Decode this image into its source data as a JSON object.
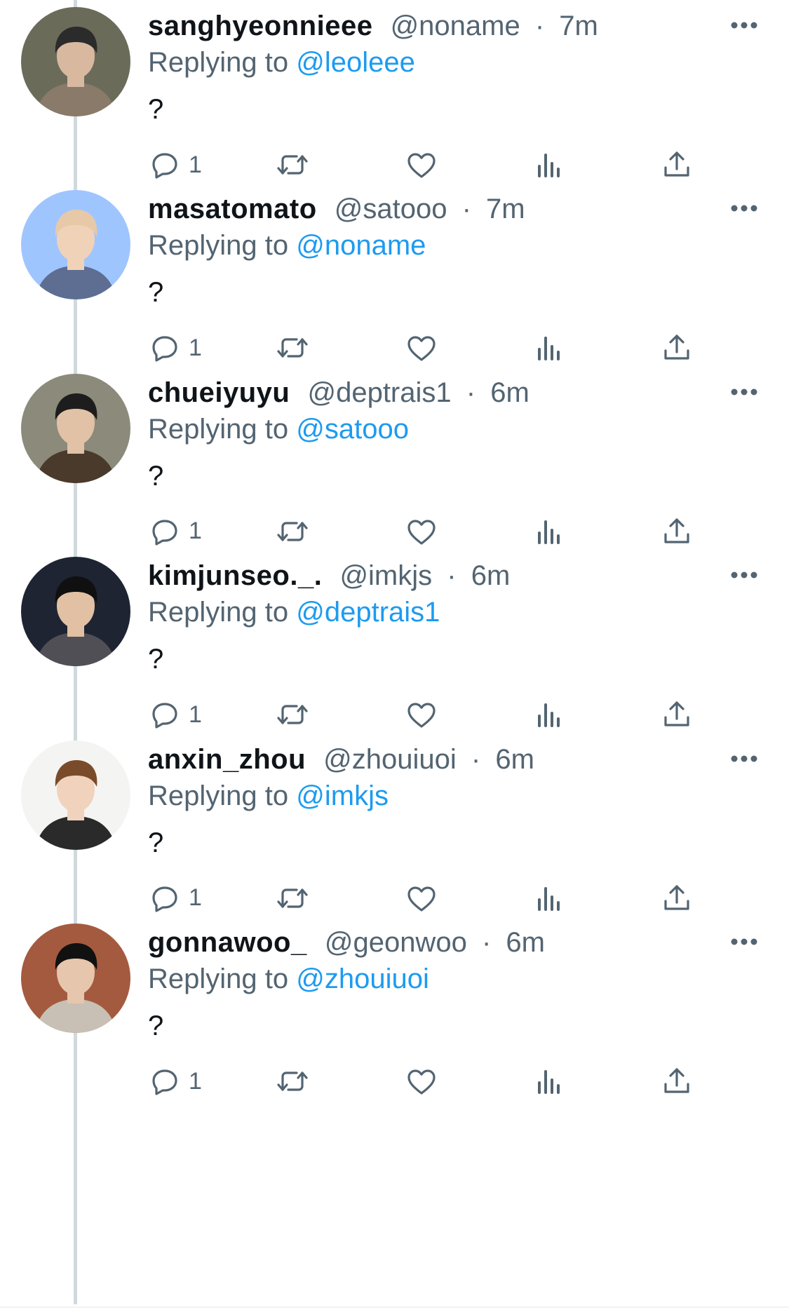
{
  "replying_prefix": "Replying to",
  "tweets": [
    {
      "display_name": "sanghyeonnieee",
      "handle": "@noname",
      "time": "7m",
      "reply_to": "@leoleee",
      "text": "?",
      "reply_count": "1"
    },
    {
      "display_name": "masatomato",
      "handle": "@satooo",
      "time": "7m",
      "reply_to": "@noname",
      "text": "?",
      "reply_count": "1"
    },
    {
      "display_name": "chueiyuyu",
      "handle": "@deptrais1",
      "time": "6m",
      "reply_to": "@satooo",
      "text": "?",
      "reply_count": "1"
    },
    {
      "display_name": "kimjunseo._.",
      "handle": "@imkjs",
      "time": "6m",
      "reply_to": "@deptrais1",
      "text": "?",
      "reply_count": "1"
    },
    {
      "display_name": "anxin_zhou",
      "handle": "@zhouiuoi",
      "time": "6m",
      "reply_to": "@imkjs",
      "text": "?",
      "reply_count": "1"
    },
    {
      "display_name": "gonnawoo_",
      "handle": "@geonwoo",
      "time": "6m",
      "reply_to": "@zhouiuoi",
      "text": "?",
      "reply_count": "1"
    }
  ],
  "separator": "·",
  "icons": {
    "reply": "reply-icon",
    "retweet": "retweet-icon",
    "like": "heart-icon",
    "views": "views-icon",
    "share": "share-icon",
    "more": "more-icon"
  },
  "colors": {
    "link": "#1d9bf0",
    "muted": "#536471",
    "text": "#0f1419",
    "thread_line": "#cfd9de"
  }
}
